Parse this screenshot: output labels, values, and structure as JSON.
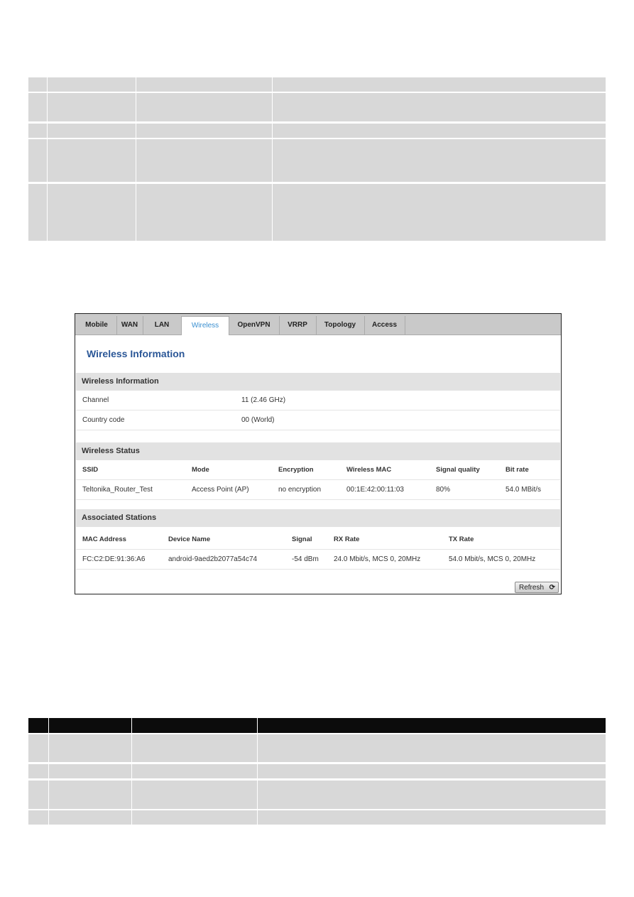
{
  "tabs": [
    "Mobile",
    "WAN",
    "LAN",
    "Wireless",
    "OpenVPN",
    "VRRP",
    "Topology",
    "Access"
  ],
  "active_tab": "Wireless",
  "page_title": "Wireless Information",
  "wireless_information": {
    "title": "Wireless Information",
    "rows": [
      {
        "label": "Channel",
        "value": "11 (2.46 GHz)"
      },
      {
        "label": "Country code",
        "value": "00 (World)"
      }
    ]
  },
  "wireless_status": {
    "title": "Wireless Status",
    "headers": [
      "SSID",
      "Mode",
      "Encryption",
      "Wireless MAC",
      "Signal quality",
      "Bit rate"
    ],
    "row": [
      "Teltonika_Router_Test",
      "Access Point (AP)",
      "no encryption",
      "00:1E:42:00:11:03",
      "80%",
      "54.0 MBit/s"
    ]
  },
  "associated_stations": {
    "title": "Associated Stations",
    "headers": [
      "MAC Address",
      "Device Name",
      "Signal",
      "RX Rate",
      "TX Rate"
    ],
    "row": [
      "FC:C2:DE:91:36:A6",
      "android-9aed2b2077a54c74",
      "-54 dBm",
      "24.0 Mbit/s, MCS 0, 20MHz",
      "54.0 Mbit/s, MCS 0, 20MHz"
    ]
  },
  "refresh_label": "Refresh",
  "refresh_icon": "refresh-icon"
}
